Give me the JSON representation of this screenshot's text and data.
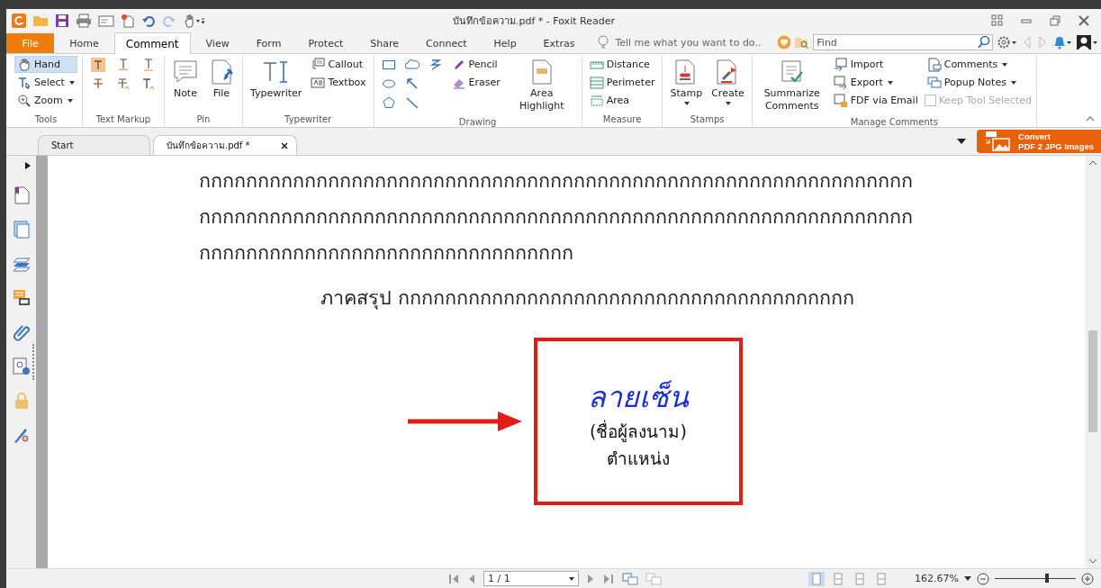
{
  "window": {
    "title": "บันทึกข้อความ.pdf * - Foxit Reader"
  },
  "menu_tabs": [
    {
      "label": "File",
      "kind": "file",
      "selected": false
    },
    {
      "label": "Home",
      "kind": "tab",
      "selected": false
    },
    {
      "label": "Comment",
      "kind": "tab",
      "selected": true
    },
    {
      "label": "View",
      "kind": "tab",
      "selected": false
    },
    {
      "label": "Form",
      "kind": "tab",
      "selected": false
    },
    {
      "label": "Protect",
      "kind": "tab",
      "selected": false
    },
    {
      "label": "Share",
      "kind": "tab",
      "selected": false
    },
    {
      "label": "Connect",
      "kind": "tab",
      "selected": false
    },
    {
      "label": "Help",
      "kind": "tab",
      "selected": false
    },
    {
      "label": "Extras",
      "kind": "tab",
      "selected": false
    }
  ],
  "tell_me": {
    "placeholder": "Tell me what you want to do.."
  },
  "find": {
    "placeholder": "Find"
  },
  "ribbon": [
    {
      "title": "Tools",
      "columns": [
        [
          {
            "kind": "small",
            "label": "Hand",
            "dropdown": false,
            "selected": true
          },
          {
            "kind": "small",
            "label": "Select",
            "dropdown": true,
            "selected": false
          },
          {
            "kind": "small",
            "label": "Zoom",
            "dropdown": true,
            "selected": false
          }
        ]
      ]
    },
    {
      "title": "Text Markup",
      "columns": [
        [
          {
            "kind": "icon",
            "selected": false
          },
          {
            "kind": "icon",
            "selected": false
          }
        ],
        [
          {
            "kind": "icon",
            "selected": false
          },
          {
            "kind": "icon",
            "selected": false
          }
        ],
        [
          {
            "kind": "icon",
            "selected": false
          },
          {
            "kind": "icon",
            "selected": false
          }
        ]
      ]
    },
    {
      "title": "Pin",
      "columns": [
        [
          {
            "kind": "large",
            "label": "Note",
            "dropdown": false,
            "selected": false
          }
        ],
        [
          {
            "kind": "large",
            "label": "File",
            "dropdown": false,
            "selected": false
          }
        ]
      ]
    },
    {
      "title": "Typewriter",
      "columns": [
        [
          {
            "kind": "large",
            "label": "Typewriter",
            "dropdown": false,
            "selected": false
          }
        ],
        [
          {
            "kind": "small",
            "label": "Callout",
            "dropdown": false,
            "selected": false
          },
          {
            "kind": "small",
            "label": "Textbox",
            "dropdown": false,
            "selected": false
          }
        ]
      ]
    },
    {
      "title": "Drawing",
      "columns": [
        [
          {
            "kind": "icon",
            "selected": false
          },
          {
            "kind": "icon",
            "selected": false
          },
          {
            "kind": "icon",
            "selected": false
          }
        ],
        [
          {
            "kind": "icon",
            "selected": false
          },
          {
            "kind": "icon",
            "selected": false
          },
          {
            "kind": "icon",
            "selected": false
          }
        ],
        [
          {
            "kind": "icon",
            "selected": false
          }
        ],
        [
          {
            "kind": "small",
            "label": "Pencil",
            "dropdown": false,
            "selected": false
          },
          {
            "kind": "small",
            "label": "Eraser",
            "dropdown": false,
            "selected": false
          }
        ],
        [
          {
            "kind": "large",
            "label": "Area Highlight",
            "dropdown": false,
            "selected": false
          }
        ]
      ]
    },
    {
      "title": "Measure",
      "columns": [
        [
          {
            "kind": "small",
            "label": "Distance",
            "dropdown": false,
            "selected": false
          },
          {
            "kind": "small",
            "label": "Perimeter",
            "dropdown": false,
            "selected": false
          },
          {
            "kind": "small",
            "label": "Area",
            "dropdown": false,
            "selected": false
          }
        ]
      ]
    },
    {
      "title": "Stamps",
      "columns": [
        [
          {
            "kind": "large",
            "label": "Stamp",
            "dropdown": true,
            "selected": false
          }
        ],
        [
          {
            "kind": "large",
            "label": "Create",
            "dropdown": true,
            "selected": false
          }
        ]
      ]
    },
    {
      "title": "Manage Comments",
      "columns": [
        [
          {
            "kind": "large",
            "label": "Summarize Comments",
            "dropdown": false,
            "selected": false
          }
        ],
        [
          {
            "kind": "small",
            "label": "Import",
            "dropdown": false,
            "selected": false
          },
          {
            "kind": "small",
            "label": "Export",
            "dropdown": true,
            "selected": false
          },
          {
            "kind": "small",
            "label": "FDF via Email",
            "dropdown": false,
            "selected": false
          }
        ],
        [
          {
            "kind": "small",
            "label": "Comments",
            "dropdown": true,
            "selected": false
          },
          {
            "kind": "small",
            "label": "Popup Notes",
            "dropdown": true,
            "selected": false
          },
          {
            "kind": "checkbox",
            "label": "Keep Tool Selected",
            "checked": false,
            "disabled": true
          }
        ]
      ]
    }
  ],
  "doc_tabs": [
    {
      "label": "Start",
      "selected": false,
      "closable": false
    },
    {
      "label": "บันทึกข้อความ.pdf *",
      "selected": true,
      "closable": true
    }
  ],
  "convert_button": {
    "title": "Convert",
    "subtitle": "PDF 2 JPG Images"
  },
  "document": {
    "paragraph_lines": [
      "กกกกกกกกกกกกกกกกกกกกกกกกกกกกกกกกกกกกกกกกกกกกกกกกกกกกกกกกกกกกก",
      "กกกกกกกกกกกกกกกกกกกกกกกกกกกกกกกกกกกกกกกกกกกกกกกกกกกกกกกกกกกกก",
      "กกกกกกกกกกกกกกกกกกกกกกกกกกกกกกกก"
    ],
    "conclusion": "ภาคสรุป กกกกกกกกกกกกกกกกกกกกกกกกกกกกกกกกกกกกกกก",
    "signature": {
      "handwriting": "ลายเซ็น",
      "name": "(ชื่อผู้ลงนาม)",
      "position": "ตำแหน่ง"
    }
  },
  "status_bar": {
    "page": "1 / 1",
    "zoom": "162.67%",
    "zoom_slider": {
      "level": 0.62
    },
    "view_modes": [
      {
        "selected": true
      },
      {
        "selected": false
      },
      {
        "selected": false
      },
      {
        "selected": false
      }
    ]
  }
}
